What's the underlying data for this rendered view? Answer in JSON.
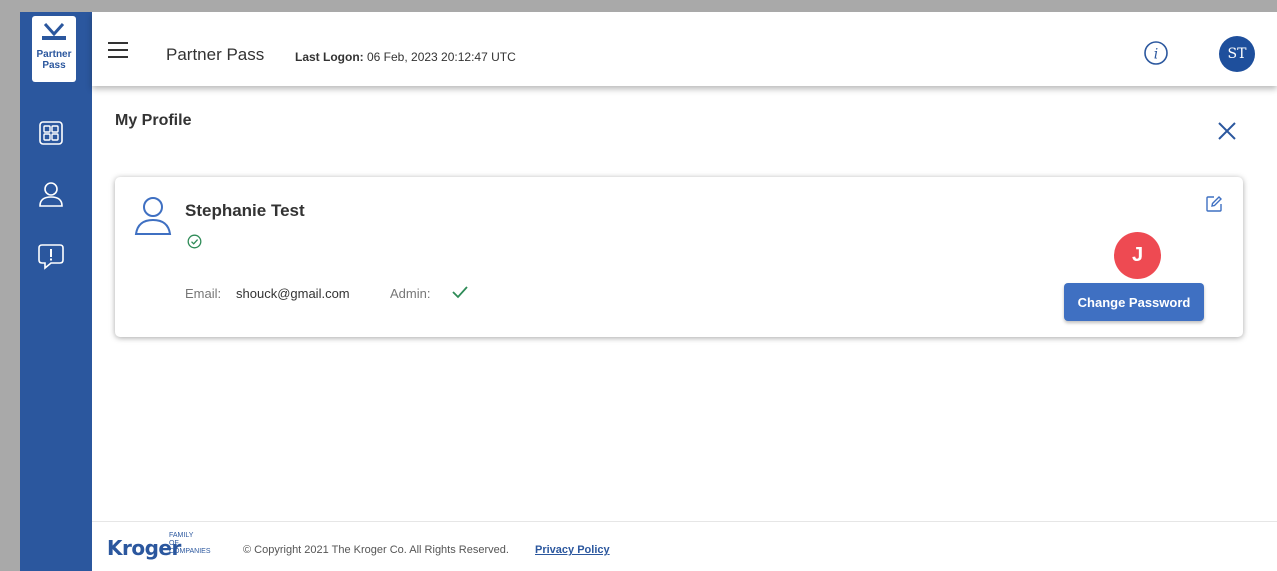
{
  "sidebar": {
    "logo_line1": "Partner",
    "logo_line2": "Pass",
    "items": [
      {
        "name": "dashboard",
        "icon": "grid-icon"
      },
      {
        "name": "profile",
        "icon": "user-icon"
      },
      {
        "name": "feedback",
        "icon": "alert-message-icon"
      }
    ]
  },
  "header": {
    "title": "Partner Pass",
    "last_logon_label": "Last Logon:",
    "last_logon_value": "06 Feb, 2023 20:12:47 UTC",
    "avatar_initials": "ST",
    "info_icon": "info-icon"
  },
  "main": {
    "page_title": "My Profile",
    "profile": {
      "name": "Stephanie Test",
      "email_label": "Email:",
      "email_value": "shouck@gmail.com",
      "admin_label": "Admin:",
      "admin_value": true
    },
    "badge_letter": "J",
    "change_password_label": "Change Password"
  },
  "footer": {
    "brand_name": "Kroger",
    "brand_family_1": "FAMILY",
    "brand_family_2": "OF",
    "brand_family_3": "COMPANIES",
    "copyright": "© Copyright 2021 The Kroger Co. All Rights Reserved.",
    "privacy_label": "Privacy Policy"
  },
  "colors": {
    "sidebar": "#2b579e",
    "primary_button": "#3f70c2",
    "badge": "#ee4a52",
    "success": "#2e8b57"
  }
}
